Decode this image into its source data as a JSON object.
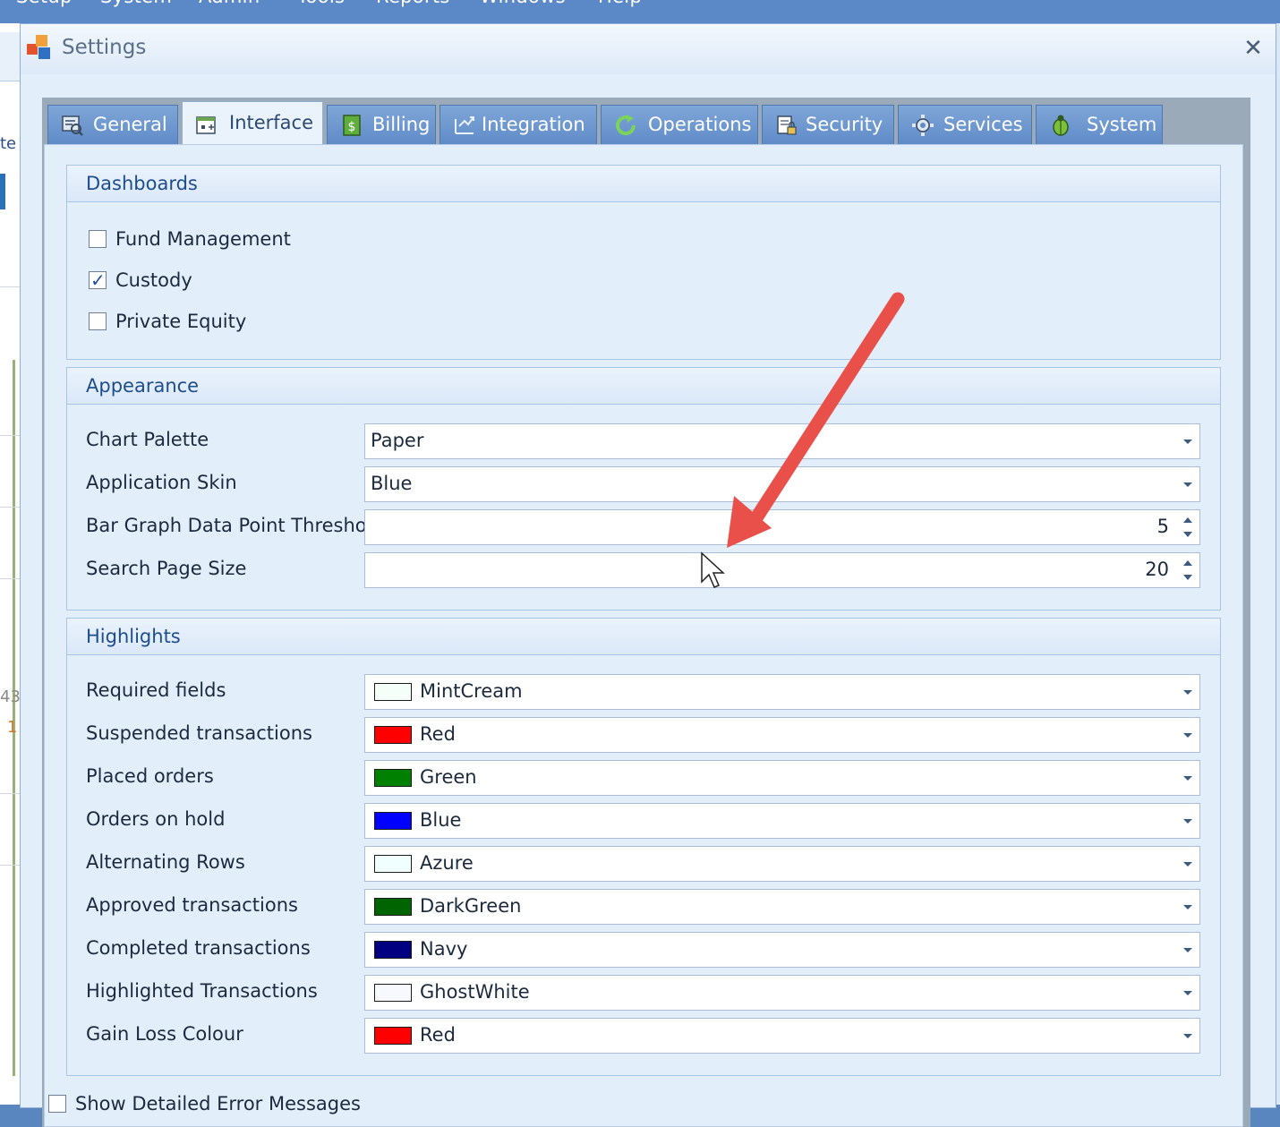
{
  "menubar": {
    "items": [
      "Setup",
      "System",
      "Admin",
      "Tools",
      "Reports",
      "Windows",
      "Help"
    ]
  },
  "background_app": {
    "fragments": [
      "te",
      "43",
      "1"
    ]
  },
  "dialog": {
    "title": "Settings",
    "close_glyph": "✕"
  },
  "tabs": [
    {
      "label": "General",
      "icon": "general-icon"
    },
    {
      "label": "Interface",
      "icon": "interface-icon",
      "active": true
    },
    {
      "label": "Billing",
      "icon": "billing-icon"
    },
    {
      "label": "Integration",
      "icon": "integration-icon"
    },
    {
      "label": "Operations",
      "icon": "operations-icon"
    },
    {
      "label": "Security",
      "icon": "security-icon"
    },
    {
      "label": "Services",
      "icon": "gear-icon"
    },
    {
      "label": "System",
      "icon": "bug-icon"
    }
  ],
  "dashboards": {
    "title": "Dashboards",
    "items": [
      {
        "label": "Fund Management",
        "checked": false
      },
      {
        "label": "Custody",
        "checked": true
      },
      {
        "label": "Private Equity",
        "checked": false
      }
    ]
  },
  "appearance": {
    "title": "Appearance",
    "chart_palette": {
      "label": "Chart Palette",
      "value": "Paper"
    },
    "application_skin": {
      "label": "Application Skin",
      "value": "Blue"
    },
    "bar_threshold": {
      "label": "Bar Graph Data Point Threshold",
      "value": "5"
    },
    "search_page_size": {
      "label": "Search Page Size",
      "value": "20"
    }
  },
  "highlights": {
    "title": "Highlights",
    "rows": [
      {
        "label": "Required fields",
        "value": "MintCream",
        "color": "#F5FFFA"
      },
      {
        "label": "Suspended transactions",
        "value": "Red",
        "color": "#FF0000"
      },
      {
        "label": "Placed orders",
        "value": "Green",
        "color": "#008000"
      },
      {
        "label": "Orders on hold",
        "value": "Blue",
        "color": "#0000FF"
      },
      {
        "label": "Alternating Rows",
        "value": "Azure",
        "color": "#F0FFFF"
      },
      {
        "label": "Approved transactions",
        "value": "DarkGreen",
        "color": "#006400"
      },
      {
        "label": "Completed transactions",
        "value": "Navy",
        "color": "#000080"
      },
      {
        "label": "Highlighted Transactions",
        "value": "GhostWhite",
        "color": "#F8F8FF"
      },
      {
        "label": "Gain Loss Colour",
        "value": "Red",
        "color": "#FF0000"
      }
    ]
  },
  "footer": {
    "show_errors_label": "Show Detailed Error Messages",
    "show_errors_checked": false
  },
  "annotation": {
    "arrow_color": "#E9504A"
  }
}
